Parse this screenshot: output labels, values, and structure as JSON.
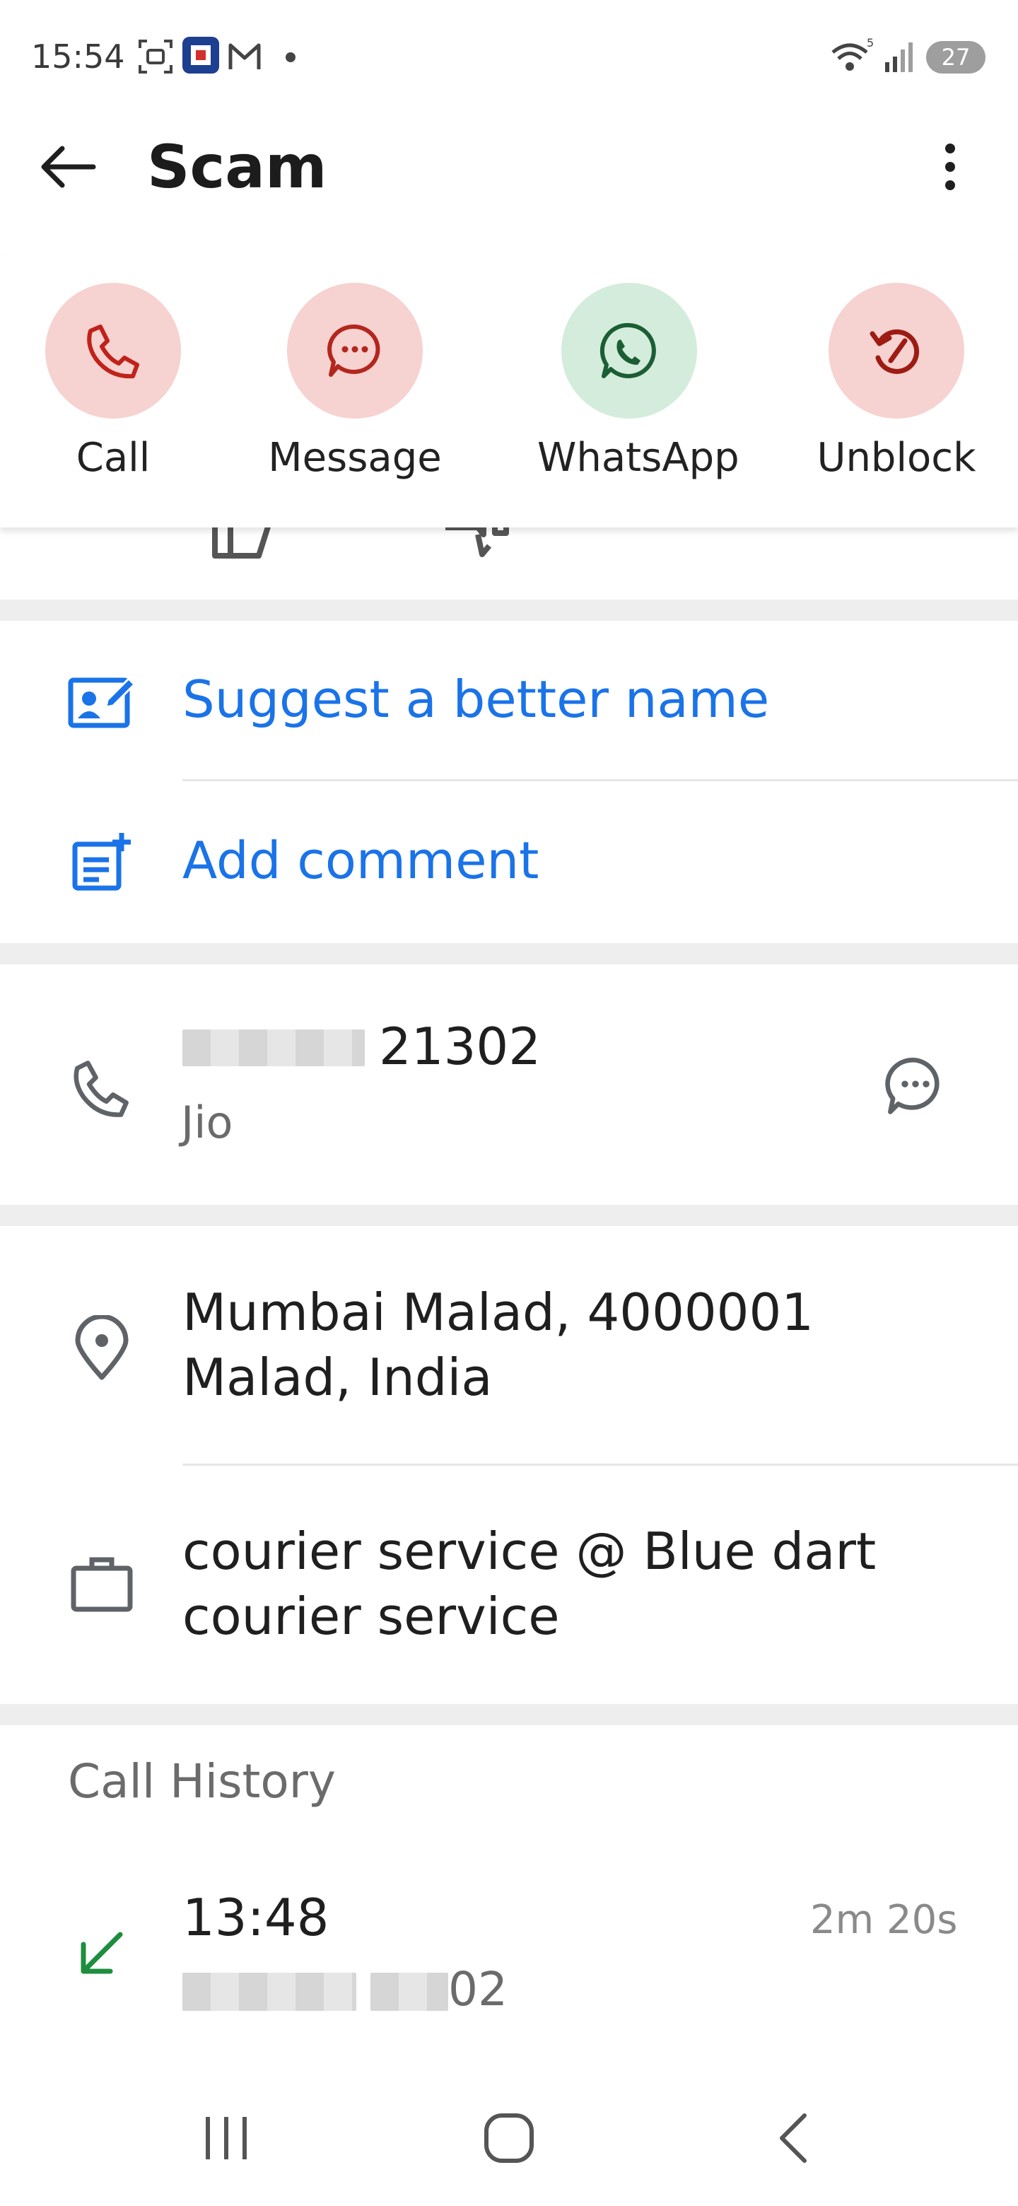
{
  "status_bar": {
    "time": "15:54",
    "battery": "27",
    "icons": [
      "screenshot-icon",
      "bank-app-icon",
      "gmail-icon",
      "notification-dot-icon",
      "wifi-icon",
      "signal-icon",
      "battery-icon"
    ]
  },
  "app_bar": {
    "title": "Scam",
    "back_icon": "arrow-back-icon",
    "more_icon": "more-vert-icon"
  },
  "actions": [
    {
      "label": "Call",
      "icon": "phone-icon",
      "bg": "#f6d2d0",
      "fg": "#c0221a"
    },
    {
      "label": "Message",
      "icon": "message-icon",
      "bg": "#f6d2d0",
      "fg": "#b3261e"
    },
    {
      "label": "WhatsApp",
      "icon": "whatsapp-icon",
      "bg": "#d4ecdb",
      "fg": "#1b5e35"
    },
    {
      "label": "Unblock",
      "icon": "unblock-icon",
      "bg": "#f6d2d0",
      "fg": "#9c1c14"
    }
  ],
  "feedback": {
    "like_icon": "thumbs-up-icon",
    "dislike_icon": "thumbs-down-icon"
  },
  "suggest": {
    "label": "Suggest a better name",
    "icon": "edit-contact-icon"
  },
  "comment": {
    "label": "Add comment",
    "icon": "add-note-icon"
  },
  "phone": {
    "number_suffix": "21302",
    "carrier": "Jio"
  },
  "location": {
    "line1": "Mumbai Malad, 4000001",
    "line2": "Malad, India"
  },
  "business": {
    "line1": "courier service @ Blue dart",
    "line2": "courier service"
  },
  "call_history": {
    "heading": "Call History",
    "entries": [
      {
        "time": "13:48",
        "duration": "2m 20s",
        "number_suffix": "02",
        "direction": "incoming"
      }
    ]
  },
  "colors": {
    "accent_blue": "#1a73e8",
    "incoming_green": "#1e8e3e"
  }
}
